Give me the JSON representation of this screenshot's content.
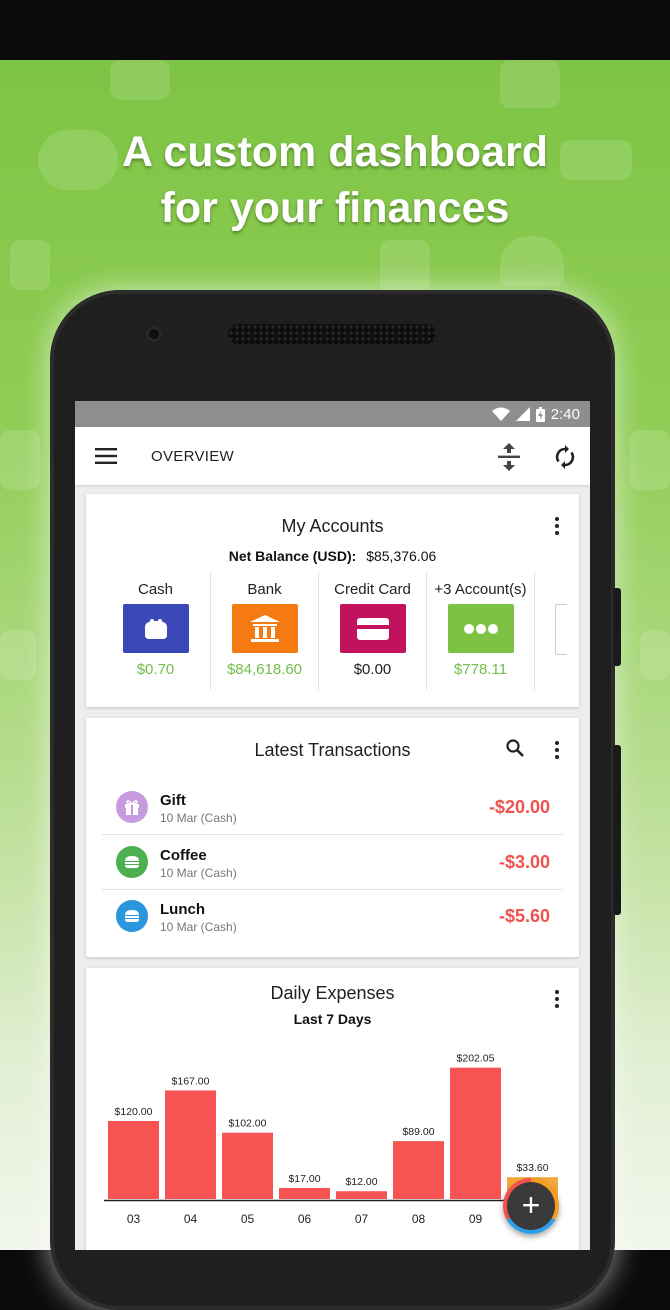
{
  "headline": {
    "line1": "A custom dashboard",
    "line2": "for your finances"
  },
  "status": {
    "time": "2:40"
  },
  "toolbar": {
    "title": "OVERVIEW",
    "menu_icon": "menu-icon",
    "sort_icon": "expand-collapse-icon",
    "sync_icon": "sync-icon"
  },
  "accounts": {
    "title": "My Accounts",
    "net_label": "Net Balance (USD):",
    "net_value": "$85,376.06",
    "items": [
      {
        "label": "Cash",
        "value": "$0.70",
        "color": "#3b48b7",
        "value_color": "#6fbf4a",
        "icon": "wallet-icon"
      },
      {
        "label": "Bank",
        "value": "$84,618.60",
        "color": "#f57a12",
        "value_color": "#6fbf4a",
        "icon": "bank-icon"
      },
      {
        "label": "Credit Card",
        "value": "$0.00",
        "color": "#c2125e",
        "value_color": "#222222",
        "icon": "credit-card-icon"
      },
      {
        "label": "+3 Account(s)",
        "value": "$778.11",
        "color": "#7ec243",
        "value_color": "#6fbf4a",
        "icon": "more-dots-icon"
      },
      {
        "label": "Ne",
        "value": "",
        "color": "#ffffff",
        "value_color": "#222222",
        "icon": "new-account-icon"
      }
    ]
  },
  "transactions": {
    "title": "Latest Transactions",
    "items": [
      {
        "name": "Gift",
        "meta": "10 Mar (Cash)",
        "amount": "-$20.00",
        "color": "#c79be0",
        "icon": "gift-icon"
      },
      {
        "name": "Coffee",
        "meta": "10 Mar (Cash)",
        "amount": "-$3.00",
        "color": "#4caf50",
        "icon": "coffee-icon"
      },
      {
        "name": "Lunch",
        "meta": "10 Mar (Cash)",
        "amount": "-$5.60",
        "color": "#2b95de",
        "icon": "burger-icon"
      }
    ]
  },
  "expenses": {
    "title": "Daily Expenses",
    "subtitle": "Last 7 Days"
  },
  "chart_data": {
    "type": "bar",
    "title": "Daily Expenses",
    "subtitle": "Last 7 Days",
    "categories": [
      "03",
      "04",
      "05",
      "06",
      "07",
      "08",
      "09",
      "10"
    ],
    "values": [
      120.0,
      167.0,
      102.0,
      17.0,
      12.0,
      89.0,
      202.05,
      33.6
    ],
    "labels": [
      "$120.00",
      "$167.00",
      "$102.00",
      "$17.00",
      "$12.00",
      "$89.00",
      "$202.05",
      "$33.60"
    ],
    "bar_colors": [
      "#f65352",
      "#f65352",
      "#f65352",
      "#f65352",
      "#f65352",
      "#f65352",
      "#f65352",
      "#f5a93a"
    ],
    "ylim": [
      0,
      220
    ],
    "grid": false
  }
}
